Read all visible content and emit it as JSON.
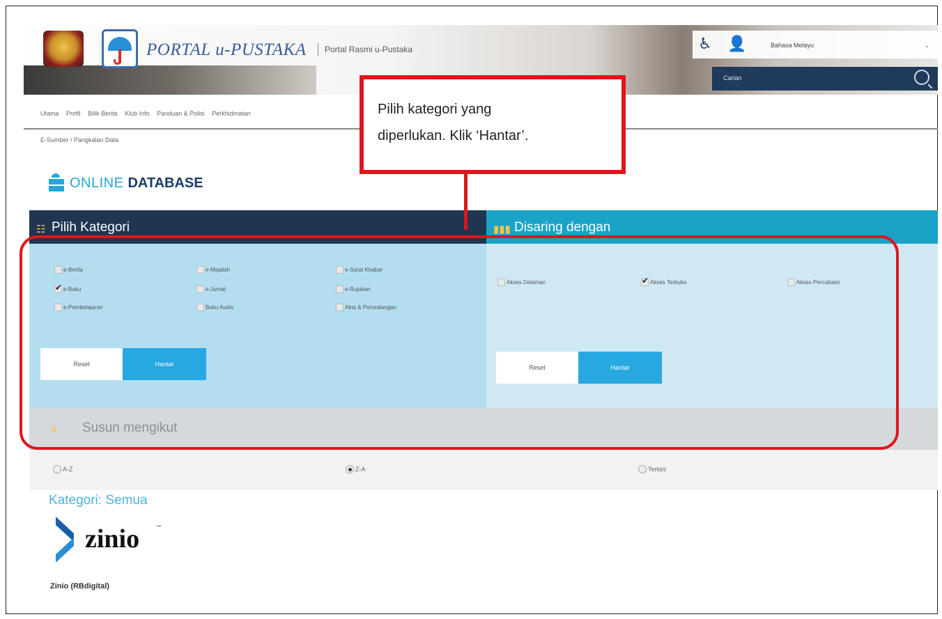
{
  "header": {
    "portal_title": "PORTAL u-PUSTAKA",
    "portal_subtitle": "Portal Rasmi u-Pustaka",
    "language": "Bahasa Melayu",
    "search_placeholder": "Carian"
  },
  "nav": {
    "items": [
      "Utama",
      "Profil",
      "Bilik Berita",
      "Klub Info",
      "Panduan & Polisi",
      "Perkhidmatan"
    ]
  },
  "breadcrumb": "E-Sumber / Pangkalan Data",
  "page_heading": {
    "online": "ONLINE",
    "database": "DATABASE"
  },
  "category_panel": {
    "title": "Pilih Kategori",
    "checkboxes": [
      {
        "label": "e-Berita",
        "checked": false
      },
      {
        "label": "e-Majalah",
        "checked": false
      },
      {
        "label": "e-Surat Khabar",
        "checked": false
      },
      {
        "label": "e-Buku",
        "checked": true
      },
      {
        "label": "e-Jurnal",
        "checked": false
      },
      {
        "label": "e-Rujukan",
        "checked": false
      },
      {
        "label": "e-Pembelajaran",
        "checked": false
      },
      {
        "label": "Buku Audio",
        "checked": false
      },
      {
        "label": "Akta & Perundangan",
        "checked": false
      }
    ],
    "reset_label": "Reset",
    "submit_label": "Hantar"
  },
  "filter_panel": {
    "title": "Disaring dengan",
    "checkboxes": [
      {
        "label": "Akses Dalaman",
        "checked": false
      },
      {
        "label": "Akses Terbuka",
        "checked": true
      },
      {
        "label": "Akses Percubaan",
        "checked": false
      }
    ],
    "reset_label": "Reset",
    "submit_label": "Hantar"
  },
  "sort": {
    "title": "Susun mengikut",
    "options": [
      {
        "label": "A-Z",
        "selected": false
      },
      {
        "label": "Z-A",
        "selected": true
      },
      {
        "label": "Terkini",
        "selected": false
      }
    ]
  },
  "results": {
    "category_label": "Kategori: Semua",
    "items": [
      {
        "logo_text": "zinio",
        "trademark": "™",
        "caption": "Zinio (RBdigital)"
      }
    ]
  },
  "annotation": {
    "callout_line1": "Pilih kategori yang",
    "callout_line2": "diperlukan. Klik ‘Hantar’.",
    "highlight_color": "#e0151b"
  },
  "colors": {
    "primary_navy": "#1f3550",
    "accent_cyan": "#1aa3c7",
    "button_blue": "#27a8e0",
    "panel_light": "#b3def0"
  }
}
